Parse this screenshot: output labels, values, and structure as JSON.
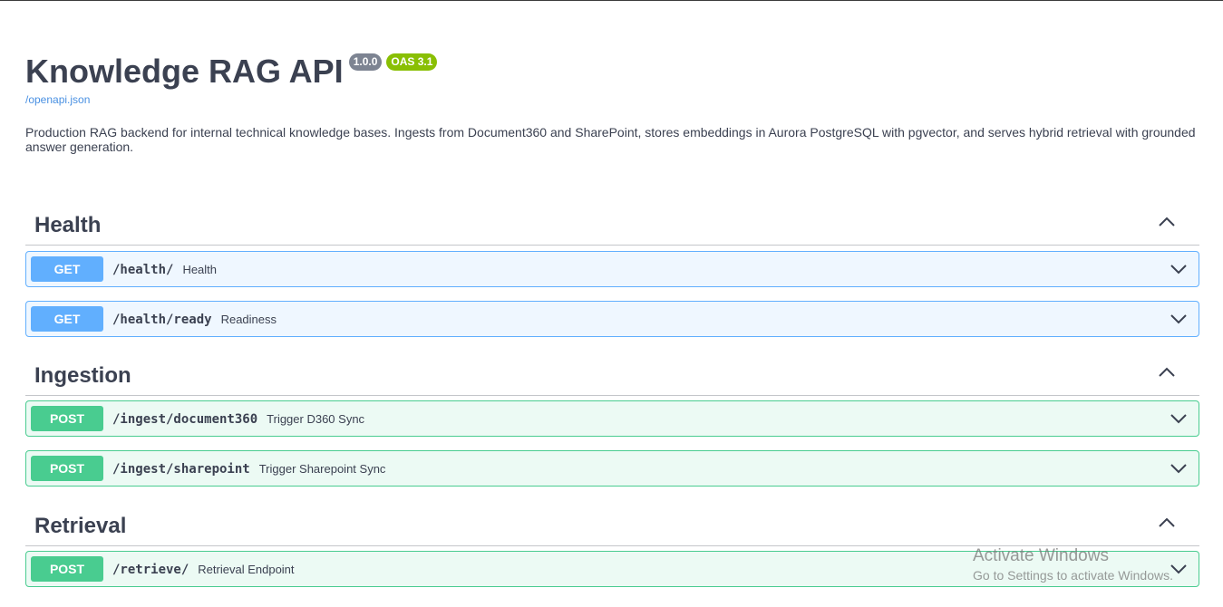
{
  "info": {
    "title": "Knowledge RAG API",
    "version": "1.0.0",
    "oas": "OAS 3.1",
    "spec_link": "/openapi.json",
    "description": "Production RAG backend for internal technical knowledge bases. Ingests from Document360 and SharePoint, stores embeddings in Aurora PostgreSQL with pgvector, and serves hybrid retrieval with grounded answer generation."
  },
  "sections": [
    {
      "name": "Health",
      "operations": [
        {
          "method": "GET",
          "path": "/health/",
          "summary": "Health"
        },
        {
          "method": "GET",
          "path": "/health/ready",
          "summary": "Readiness"
        }
      ]
    },
    {
      "name": "Ingestion",
      "operations": [
        {
          "method": "POST",
          "path": "/ingest/document360",
          "summary": "Trigger D360 Sync"
        },
        {
          "method": "POST",
          "path": "/ingest/sharepoint",
          "summary": "Trigger Sharepoint Sync"
        }
      ]
    },
    {
      "name": "Retrieval",
      "operations": [
        {
          "method": "POST",
          "path": "/retrieve/",
          "summary": "Retrieval Endpoint"
        }
      ]
    }
  ],
  "watermark": {
    "line1": "Activate Windows",
    "line2": "Go to Settings to activate Windows."
  },
  "colors": {
    "get": "#61affe",
    "post": "#49cc90",
    "text": "#3b4151",
    "link": "#4990e2"
  },
  "icons": {
    "collapse": "chevron-up-icon",
    "expand": "chevron-down-icon"
  }
}
